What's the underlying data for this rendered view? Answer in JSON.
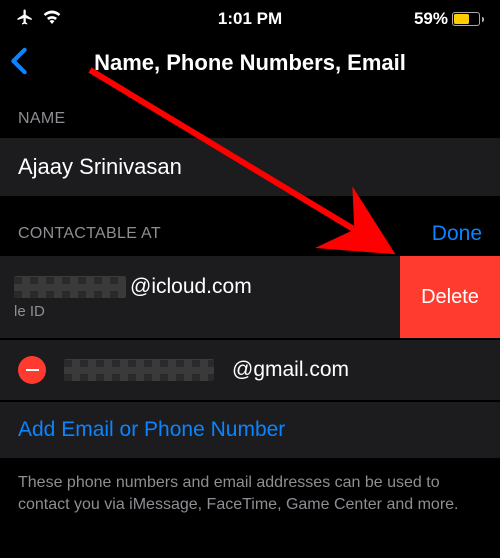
{
  "status": {
    "time": "1:01 PM",
    "battery_pct": "59%"
  },
  "nav": {
    "title": "Name, Phone Numbers, Email"
  },
  "section_name": {
    "header": "NAME",
    "value": "Ajaay Srinivasan"
  },
  "section_contact": {
    "header": "CONTACTABLE AT",
    "done": "Done",
    "items": [
      {
        "suffix": "@icloud.com",
        "subtitle_suffix": "le ID",
        "delete_label": "Delete"
      },
      {
        "suffix": "@gmail.com"
      }
    ],
    "add_label": "Add Email or Phone Number"
  },
  "footer": {
    "text": "These phone numbers and email addresses can be used to contact you via iMessage, FaceTime, Game Center and more."
  }
}
